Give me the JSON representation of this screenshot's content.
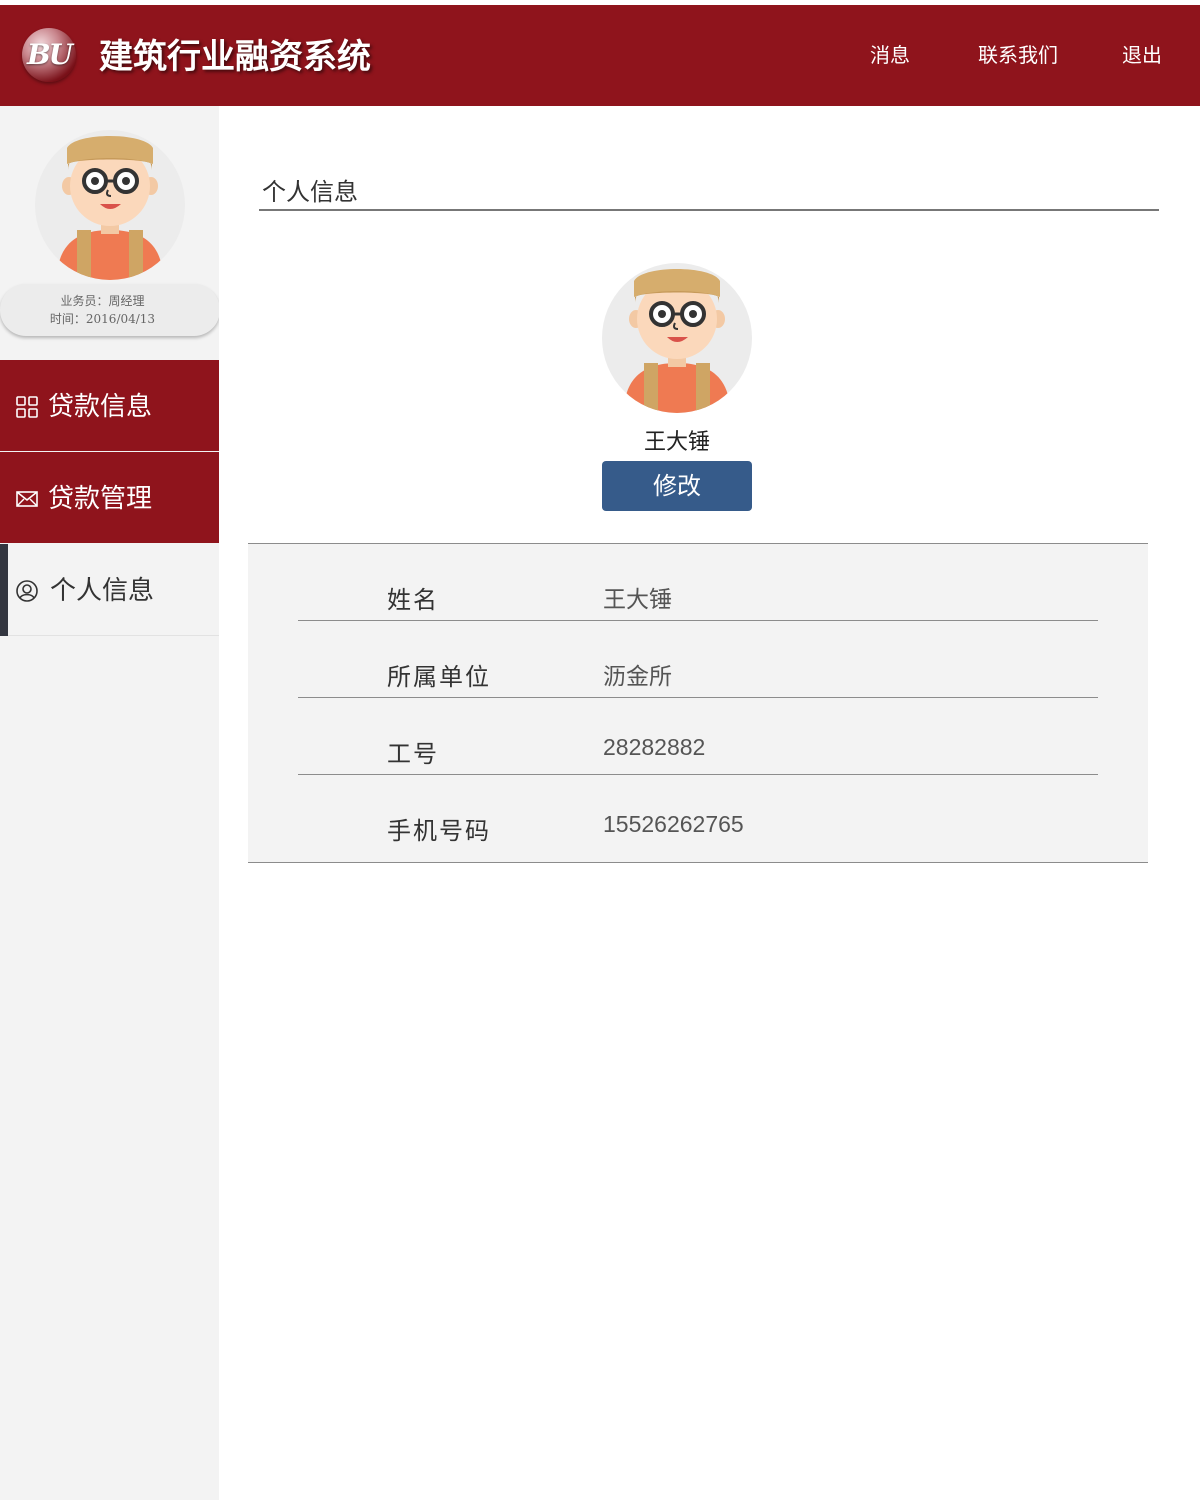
{
  "header": {
    "logo_text": "BU",
    "title": "建筑行业融资系统",
    "nav": [
      "消息",
      "联系我们",
      "退出"
    ]
  },
  "sidebar": {
    "user_role_line": "业务员：周经理",
    "date_line": "时间：2016/04/13",
    "menu": [
      {
        "label": "贷款信息",
        "icon": "grid-icon"
      },
      {
        "label": "贷款管理",
        "icon": "mail-icon"
      },
      {
        "label": "个人信息",
        "icon": "user-icon",
        "active": true
      }
    ]
  },
  "main": {
    "section_title": "个人信息",
    "profile_name": "王大锤",
    "edit_button": "修改",
    "info": [
      {
        "label": "姓名",
        "value": "王大锤"
      },
      {
        "label": "所属单位",
        "value": "沥金所"
      },
      {
        "label": "工号",
        "value": "28282882"
      },
      {
        "label": "手机号码",
        "value": "15526262765"
      }
    ]
  },
  "colors": {
    "brand_red": "#8f141c",
    "button_blue": "#365b8a",
    "sidebar_bg": "#f3f3f3"
  }
}
